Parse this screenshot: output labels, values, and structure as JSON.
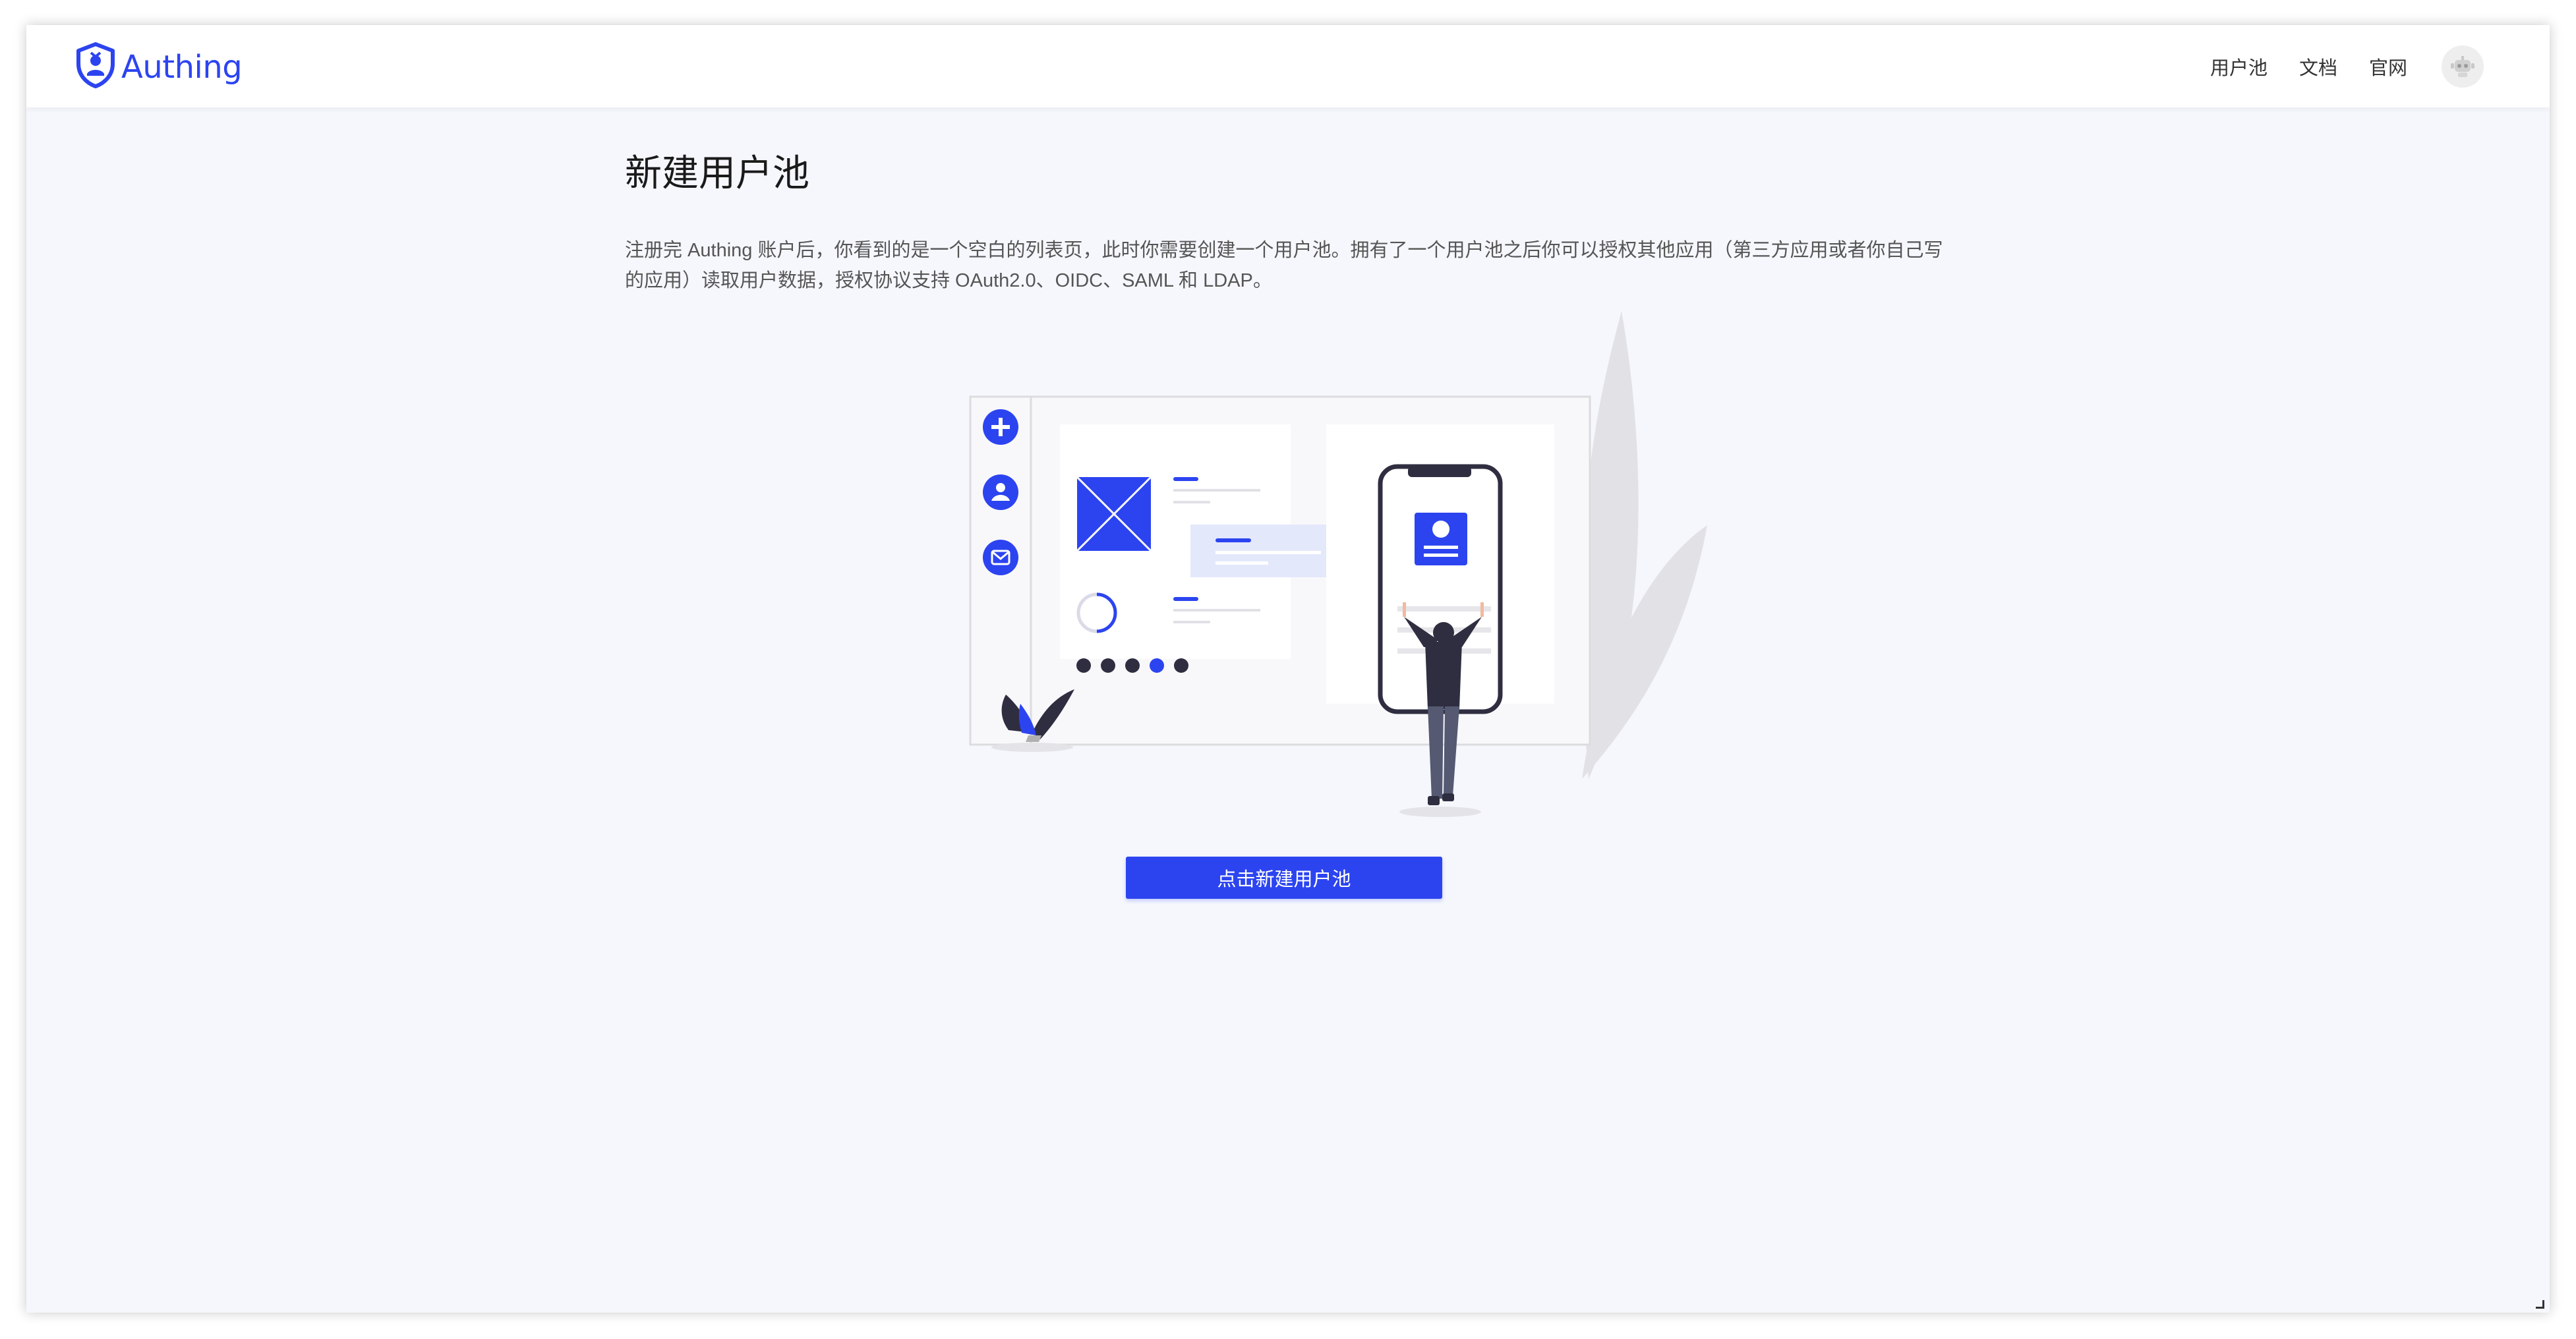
{
  "app": {
    "brand": "Authing",
    "brand_color": "#2c44f0"
  },
  "nav": {
    "items": [
      {
        "label": "用户池"
      },
      {
        "label": "文档"
      },
      {
        "label": "官网"
      }
    ],
    "avatar_icon": "robot-avatar-icon"
  },
  "main": {
    "title": "新建用户池",
    "description": "注册完 Authing 账户后，你看到的是一个空白的列表页，此时你需要创建一个用户池。拥有了一个用户池之后你可以授权其他应用（第三方应用或者你自己写的应用）读取用户数据，授权协议支持 OAuth2.0、OIDC、SAML 和 LDAP。",
    "create_button_label": "点击新建用户池",
    "illustration": {
      "sidebar_icons": [
        "plus-icon",
        "user-icon",
        "mail-icon"
      ],
      "accent": "#3d4ef5"
    }
  }
}
